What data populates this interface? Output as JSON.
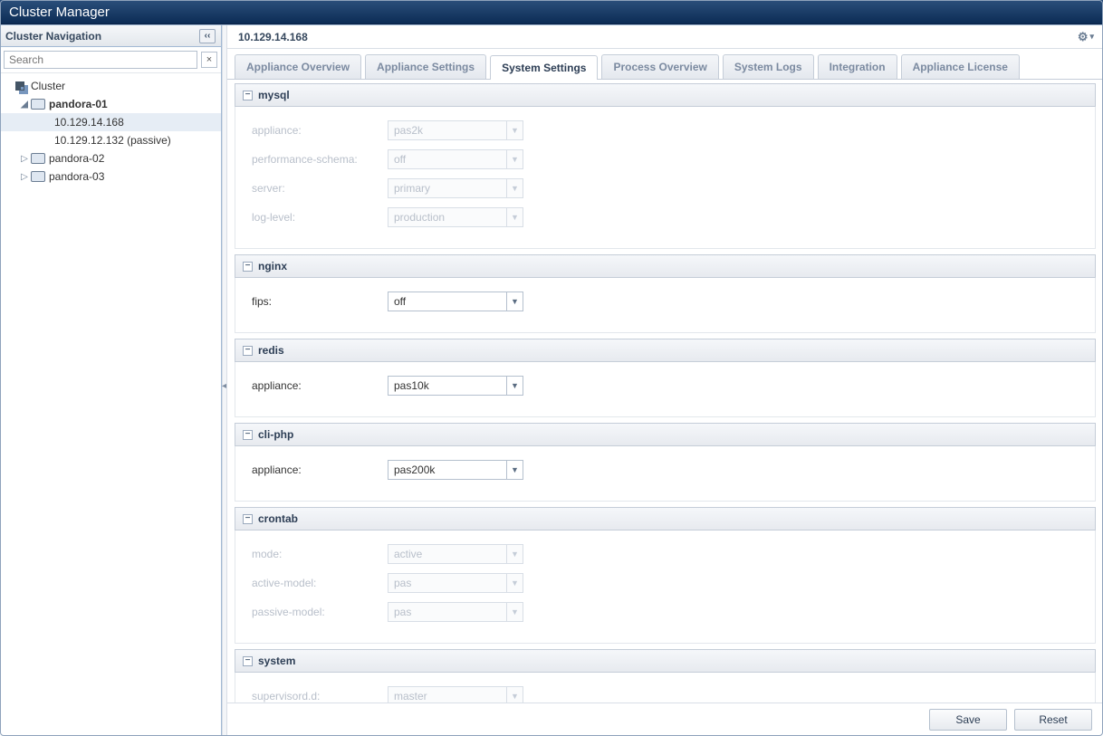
{
  "topbar": {
    "title": "Cluster Manager"
  },
  "sidebar": {
    "title": "Cluster Navigation",
    "search_placeholder": "Search",
    "tree": {
      "root": "Cluster",
      "hosts": [
        {
          "name": "pandora-01",
          "expanded": true,
          "bold": true,
          "children": [
            {
              "label": "10.129.14.168",
              "selected": true
            },
            {
              "label": "10.129.12.132 (passive)",
              "selected": false
            }
          ]
        },
        {
          "name": "pandora-02",
          "expanded": false,
          "bold": false,
          "children": []
        },
        {
          "name": "pandora-03",
          "expanded": false,
          "bold": false,
          "children": []
        }
      ]
    }
  },
  "content": {
    "title": "10.129.14.168",
    "tabs": [
      {
        "label": "Appliance Overview",
        "active": false
      },
      {
        "label": "Appliance Settings",
        "active": false
      },
      {
        "label": "System Settings",
        "active": true
      },
      {
        "label": "Process Overview",
        "active": false
      },
      {
        "label": "System Logs",
        "active": false
      },
      {
        "label": "Integration",
        "active": false
      },
      {
        "label": "Appliance License",
        "active": false
      }
    ],
    "sections": [
      {
        "name": "mysql",
        "disabled": true,
        "fields": [
          {
            "label": "appliance:",
            "value": "pas2k"
          },
          {
            "label": "performance-schema:",
            "value": "off"
          },
          {
            "label": "server:",
            "value": "primary"
          },
          {
            "label": "log-level:",
            "value": "production"
          }
        ]
      },
      {
        "name": "nginx",
        "disabled": false,
        "fields": [
          {
            "label": "fips:",
            "value": "off"
          }
        ]
      },
      {
        "name": "redis",
        "disabled": false,
        "fields": [
          {
            "label": "appliance:",
            "value": "pas10k"
          }
        ]
      },
      {
        "name": "cli-php",
        "disabled": false,
        "fields": [
          {
            "label": "appliance:",
            "value": "pas200k"
          }
        ]
      },
      {
        "name": "crontab",
        "disabled": true,
        "fields": [
          {
            "label": "mode:",
            "value": "active"
          },
          {
            "label": "active-model:",
            "value": "pas"
          },
          {
            "label": "passive-model:",
            "value": "pas"
          }
        ]
      },
      {
        "name": "system",
        "disabled": true,
        "fields": [
          {
            "label": "supervisord.d:",
            "value": "master"
          }
        ]
      }
    ],
    "buttons": {
      "save": "Save",
      "reset": "Reset"
    }
  }
}
